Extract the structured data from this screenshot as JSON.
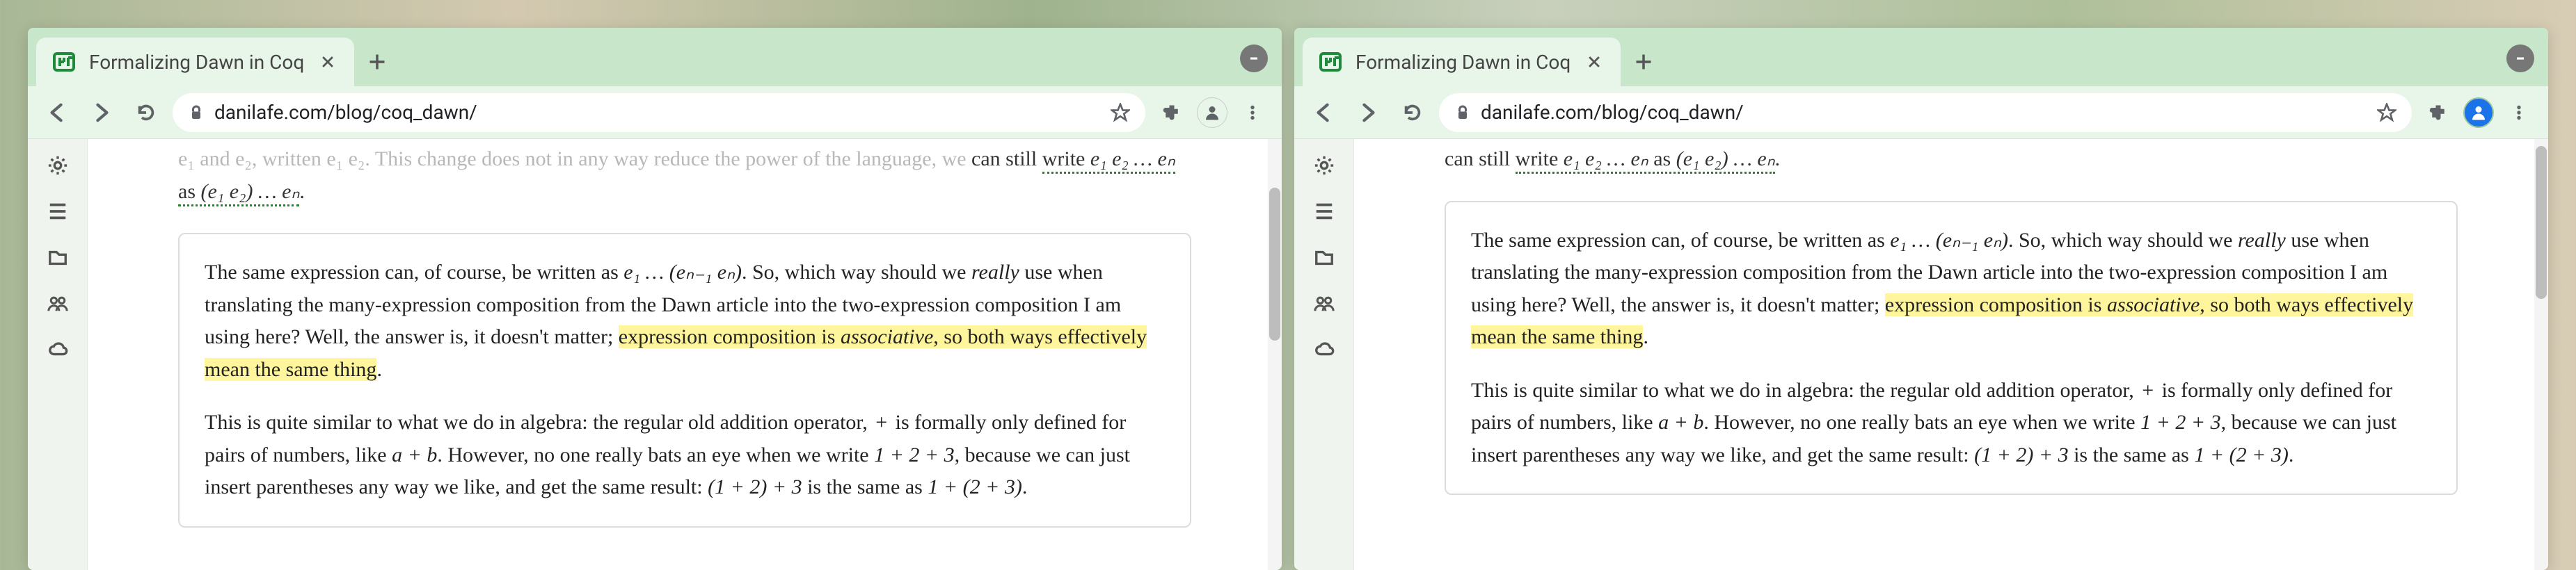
{
  "windows": [
    {
      "id": "win1",
      "tab_title": "Formalizing Dawn in Coq",
      "url": "danilafe.com/blog/coq_dawn/",
      "profile_active": false,
      "prelude": {
        "faded_line": "e₁ and e₂, written e₁ e₂. This change does not in any way reduce the power of the language, we ",
        "plain_a": "can still ",
        "dotted_b": "write ",
        "math_ab": "e₁ e₂  …  eₙ",
        "plain_c": " as ",
        "math_cd": "(e₁ e₂)  …  eₙ",
        "dot": "."
      }
    },
    {
      "id": "win2",
      "tab_title": "Formalizing Dawn in Coq",
      "url": "danilafe.com/blog/coq_dawn/",
      "profile_active": true,
      "prelude": {
        "faded_line": "",
        "plain_a": "can still ",
        "dotted_b": "write ",
        "math_ab": "e₁ e₂  …  eₙ",
        "plain_c": " as ",
        "math_cd": "(e₁ e₂)  …  eₙ",
        "dot": "."
      }
    }
  ],
  "box": {
    "p1_a": "The same expression can, of course, be written as ",
    "p1_math1": "e₁  …  (eₙ₋₁ eₙ)",
    "p1_b": ". So, which way should we ",
    "p1_really": "really",
    "p1_c": " use when translating the many-expression composition from the Dawn article into the two-expression composition I am using here? Well, the answer is, it doesn't matter; ",
    "p1_hl_a": "expression composition is ",
    "p1_hl_assoc": "associative",
    "p1_hl_b": ", so both ways effectively mean the same thing",
    "p1_hl_dot": ".",
    "p2_a": "This is quite similar to what we do in algebra: the regular old addition operator, ",
    "p2_plus": "+",
    "p2_b": " is formally only defined for pairs of numbers, like ",
    "p2_ab": "a + b",
    "p2_c": ". However, no one really bats an eye when we write ",
    "p2_123": "1 + 2 + 3",
    "p2_d": ", because we can just insert parentheses any way we like, and get the same result: ",
    "p2_lhs": "(1 + 2) + 3",
    "p2_e": " is the same as ",
    "p2_rhs": "1 + (2 + 3)",
    "p2_dot": "."
  }
}
